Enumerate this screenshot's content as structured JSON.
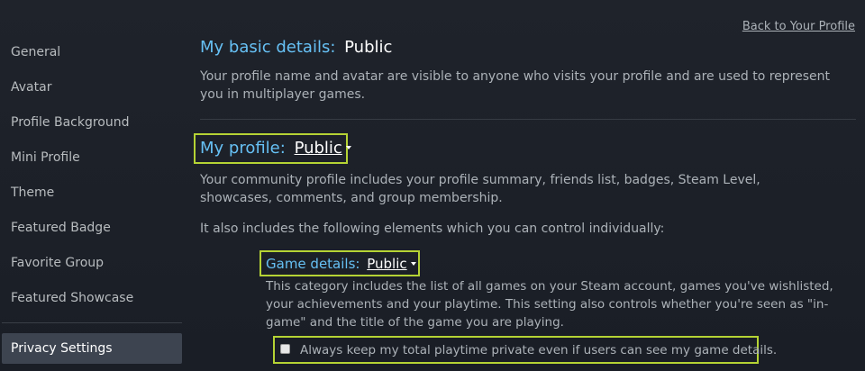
{
  "sidebar": {
    "items": [
      {
        "label": "General"
      },
      {
        "label": "Avatar"
      },
      {
        "label": "Profile Background"
      },
      {
        "label": "Mini Profile"
      },
      {
        "label": "Theme"
      },
      {
        "label": "Featured Badge"
      },
      {
        "label": "Favorite Group"
      },
      {
        "label": "Featured Showcase"
      }
    ],
    "active": {
      "label": "Privacy Settings"
    }
  },
  "header": {
    "back_link": "Back to Your Profile"
  },
  "basic_details": {
    "label": "My basic details:",
    "value": "Public",
    "description": "Your profile name and avatar are visible to anyone who visits your profile and are used to represent you in multiplayer games."
  },
  "my_profile": {
    "label": "My profile:",
    "value": "Public",
    "description": "Your community profile includes your profile summary, friends list, badges, Steam Level, showcases, comments, and group membership.",
    "elements_intro": "It also includes the following elements which you can control individually:"
  },
  "game_details": {
    "label": "Game details:",
    "value": "Public",
    "description": "This category includes the list of all games on your Steam account, games you've wishlisted, your achievements and your playtime. This setting also controls whether you're seen as \"in-game\" and the title of the game you are playing.",
    "playtime_checkbox_label": "Always keep my total playtime private even if users can see my game details.",
    "playtime_checkbox_checked": false
  },
  "colors": {
    "accent_blue": "#66c0f4",
    "highlight_outline": "#b5d334",
    "active_nav_bg": "#3d4450"
  }
}
